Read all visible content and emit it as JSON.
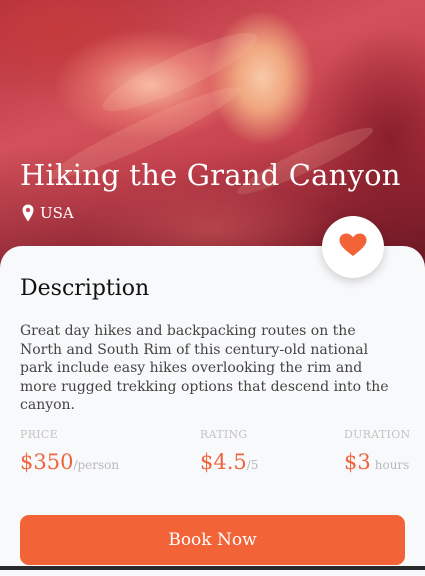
{
  "hero": {
    "title": "Hiking the Grand Canyon",
    "location": "USA",
    "location_icon": "map-pin-icon"
  },
  "favorite": {
    "icon": "heart-icon",
    "color": "#f26338"
  },
  "description": {
    "heading": "Description",
    "text": "Great day hikes and backpacking routes on the North and South Rim of this century-old national park include easy hikes overlooking the rim and more rugged trekking options that descend into the canyon."
  },
  "stats": {
    "price": {
      "label": "PRICE",
      "value": "$350",
      "unit": "/person"
    },
    "rating": {
      "label": "RATING",
      "value": "$4.5",
      "unit": "/5"
    },
    "duration": {
      "label": "DURATION",
      "value": "$3",
      "unit": "hours"
    }
  },
  "actions": {
    "book_label": "Book Now"
  },
  "colors": {
    "accent": "#f26338",
    "card_background": "#f8f9fb",
    "muted_text": "#c3c3c3"
  }
}
